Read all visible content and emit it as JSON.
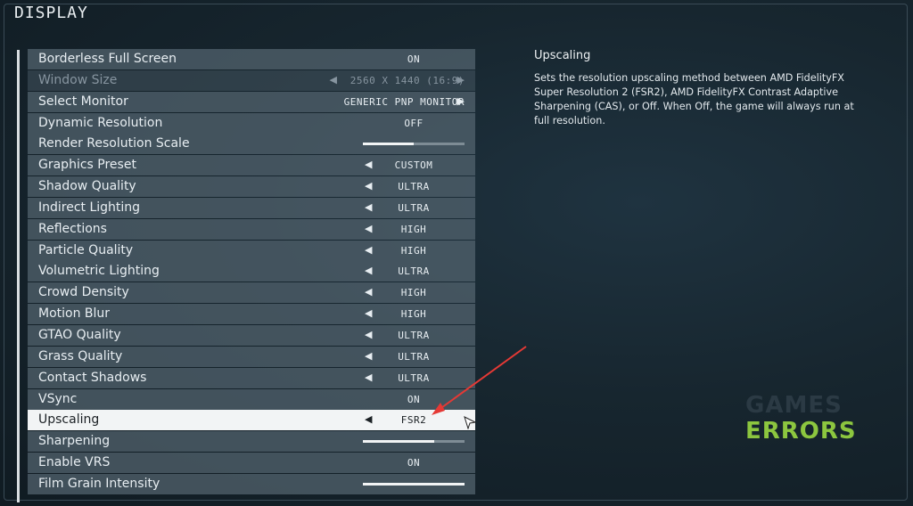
{
  "header": {
    "title": "DISPLAY"
  },
  "settings": [
    {
      "label": "Borderless Full Screen",
      "value": "ON",
      "kind": "toggle"
    },
    {
      "label": "Window Size",
      "value": "2560 X 1440 (16:9)",
      "kind": "select",
      "disabled": true
    },
    {
      "label": "Select Monitor",
      "value": "GENERIC PNP MONITOR",
      "kind": "select"
    },
    {
      "label": "Dynamic Resolution",
      "value": "OFF",
      "kind": "toggle"
    },
    {
      "label": "Render Resolution Scale",
      "kind": "slider",
      "level": 0.5
    },
    {
      "label": "Graphics Preset",
      "value": "CUSTOM",
      "kind": "cycle"
    },
    {
      "label": "Shadow Quality",
      "value": "ULTRA",
      "kind": "cycle"
    },
    {
      "label": "Indirect Lighting",
      "value": "ULTRA",
      "kind": "cycle"
    },
    {
      "label": "Reflections",
      "value": "HIGH",
      "kind": "cycle"
    },
    {
      "label": "Particle Quality",
      "value": "HIGH",
      "kind": "cycle"
    },
    {
      "label": "Volumetric Lighting",
      "value": "ULTRA",
      "kind": "cycle"
    },
    {
      "label": "Crowd Density",
      "value": "HIGH",
      "kind": "cycle"
    },
    {
      "label": "Motion Blur",
      "value": "HIGH",
      "kind": "cycle"
    },
    {
      "label": "GTAO Quality",
      "value": "ULTRA",
      "kind": "cycle"
    },
    {
      "label": "Grass Quality",
      "value": "ULTRA",
      "kind": "cycle"
    },
    {
      "label": "Contact Shadows",
      "value": "ULTRA",
      "kind": "cycle"
    },
    {
      "label": "VSync",
      "value": "ON",
      "kind": "toggle"
    },
    {
      "label": "Upscaling",
      "value": "FSR2",
      "kind": "cycle",
      "selected": true
    },
    {
      "label": "Sharpening",
      "kind": "slider",
      "level": 0.7
    },
    {
      "label": "Enable VRS",
      "value": "ON",
      "kind": "toggle"
    },
    {
      "label": "Film Grain Intensity",
      "kind": "slider",
      "level": 1.0
    }
  ],
  "description": {
    "title": "Upscaling",
    "text": "Sets the resolution upscaling method between AMD FidelityFX Super Resolution 2 (FSR2), AMD FidelityFX Contrast Adaptive Sharpening (CAS), or Off.  When Off, the game will always run at full resolution."
  },
  "watermark": {
    "line1": "GAMES",
    "line2": "ERRORS"
  },
  "colors": {
    "accent_green": "#8cc63f",
    "annotation_red": "#e53935",
    "selected_row": "#f2f4f5"
  },
  "icons": {
    "cycle_left": "triangle-left-icon",
    "cycle_right": "triangle-right-icon",
    "cursor": "mouse-pointer-icon"
  }
}
